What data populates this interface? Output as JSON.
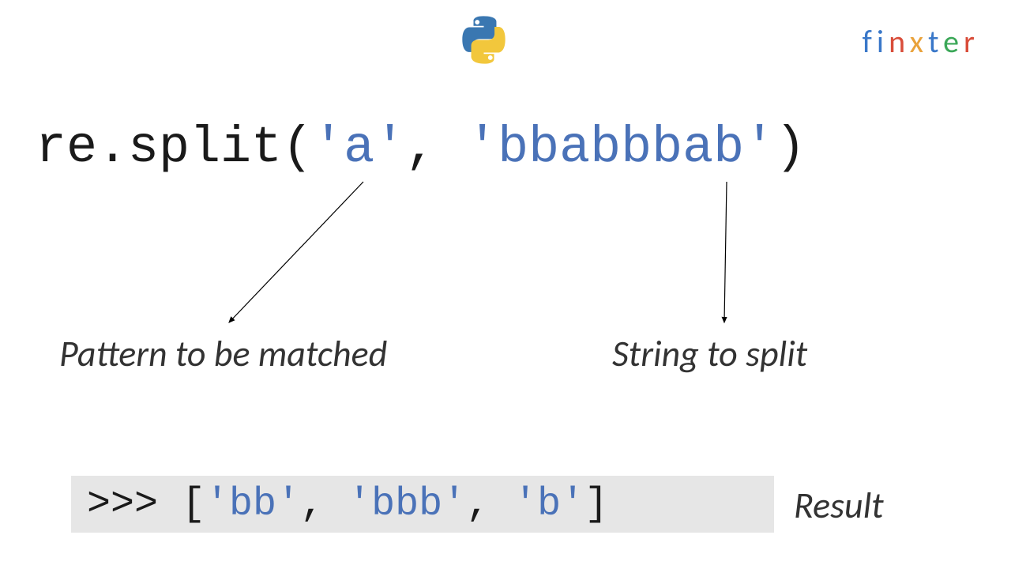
{
  "brand": {
    "name": "finxter",
    "letters": [
      "f",
      "i",
      "n",
      "x",
      "t",
      "e",
      "r"
    ]
  },
  "code": {
    "prefix": "re.split(",
    "arg1": "'a'",
    "sep": ", ",
    "arg2": "'bbabbbab'",
    "suffix": ")"
  },
  "labels": {
    "pattern": "Pattern to be matched",
    "string": "String to split",
    "result": "Result"
  },
  "result": {
    "prompt": ">>> ",
    "open": "[",
    "items": [
      "'bb'",
      "'bbb'",
      "'b'"
    ],
    "sep": ", ",
    "close": "]"
  }
}
